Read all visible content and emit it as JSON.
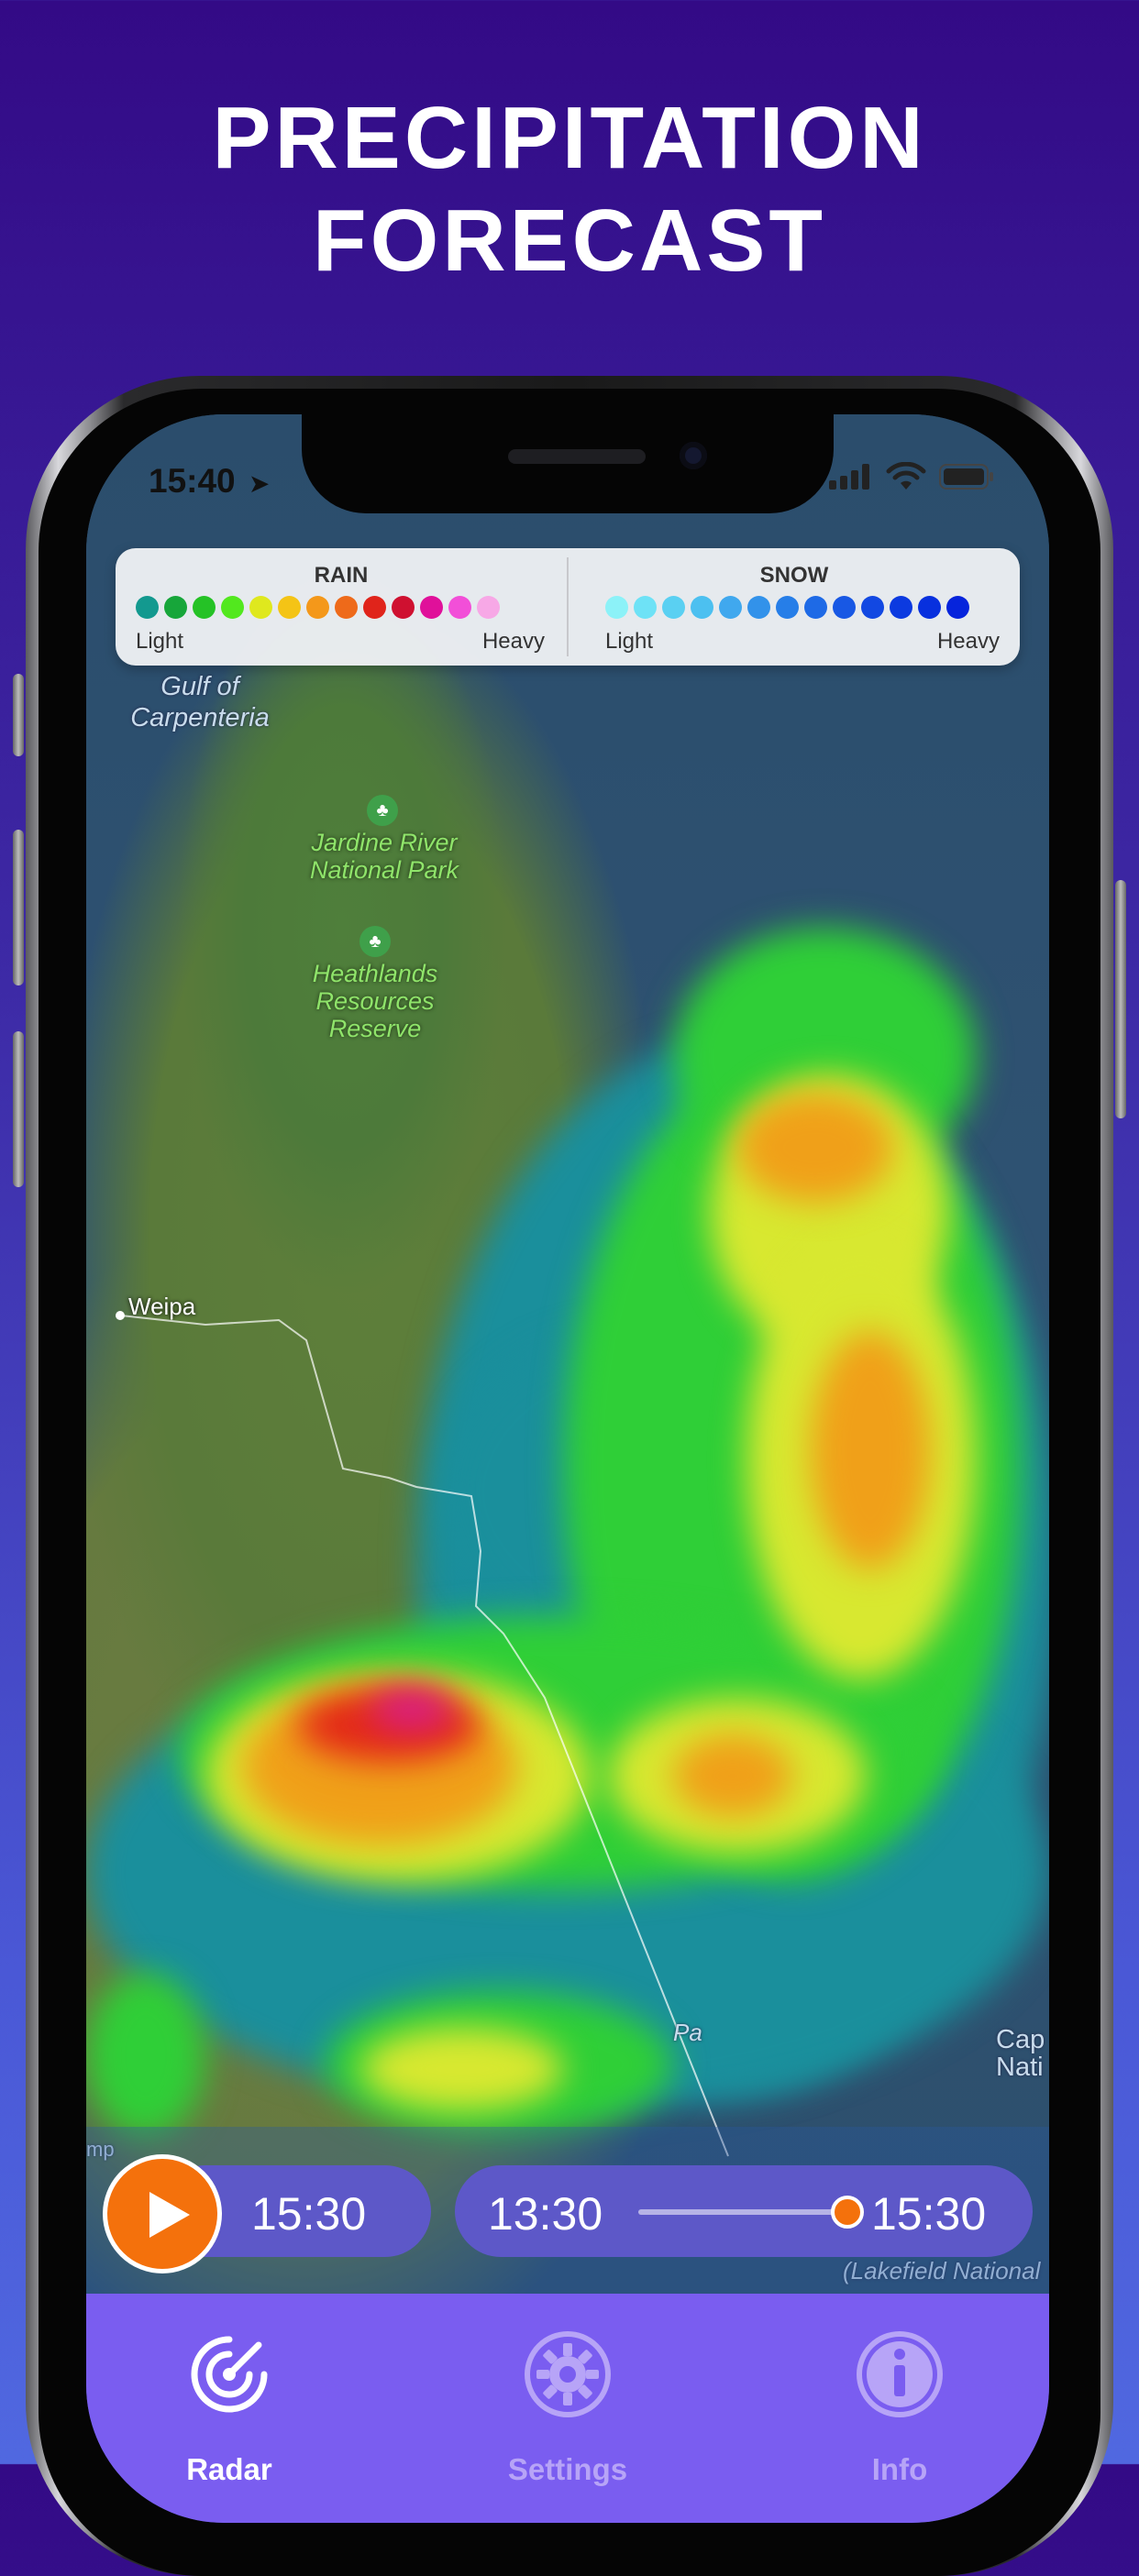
{
  "headline": {
    "line1": "PRECIPITATION",
    "line2": "FORECAST"
  },
  "status_bar": {
    "time": "15:40"
  },
  "legend": {
    "rain": {
      "title": "RAIN",
      "light": "Light",
      "heavy": "Heavy",
      "colors": [
        "#13998f",
        "#17a63a",
        "#25c226",
        "#52e81e",
        "#dfe81e",
        "#f4c416",
        "#f4981a",
        "#ee6a1a",
        "#e0241b",
        "#cf1030",
        "#e0109a",
        "#f24fd8",
        "#f7a8e6"
      ]
    },
    "snow": {
      "title": "SNOW",
      "light": "Light",
      "heavy": "Heavy",
      "colors": [
        "#8cf2f8",
        "#6ee2f6",
        "#5ad0f2",
        "#4cc0f0",
        "#40a8ee",
        "#3292ea",
        "#267ee8",
        "#1e6ae6",
        "#1858e4",
        "#1248e2",
        "#0c3ae0",
        "#0830de",
        "#0624dc"
      ]
    }
  },
  "map_labels": {
    "gulf_line1": "Gulf of",
    "gulf_line2": "Carpenteria",
    "park1": "Jardine River National Park",
    "park2": "Heathlands Resources Reserve",
    "city": "Weipa",
    "edge_right": "Cap Nati",
    "edge_bottom": "(Lakefield National",
    "edge_left": "mp",
    "fragment_pa": "Pa"
  },
  "controls": {
    "current_time": "15:30",
    "range_start": "13:30",
    "range_end": "15:30",
    "slider_position": 1.0
  },
  "tabs": [
    {
      "label": "Radar",
      "icon": "radar-icon",
      "active": true
    },
    {
      "label": "Settings",
      "icon": "gear-icon",
      "active": false
    },
    {
      "label": "Info",
      "icon": "info-icon",
      "active": false
    }
  ],
  "colors": {
    "accent": "#f4710c",
    "tabbar": "#7a5df0",
    "active_tab": "#ffffff",
    "inactive_tab": "#b7a4f7"
  }
}
